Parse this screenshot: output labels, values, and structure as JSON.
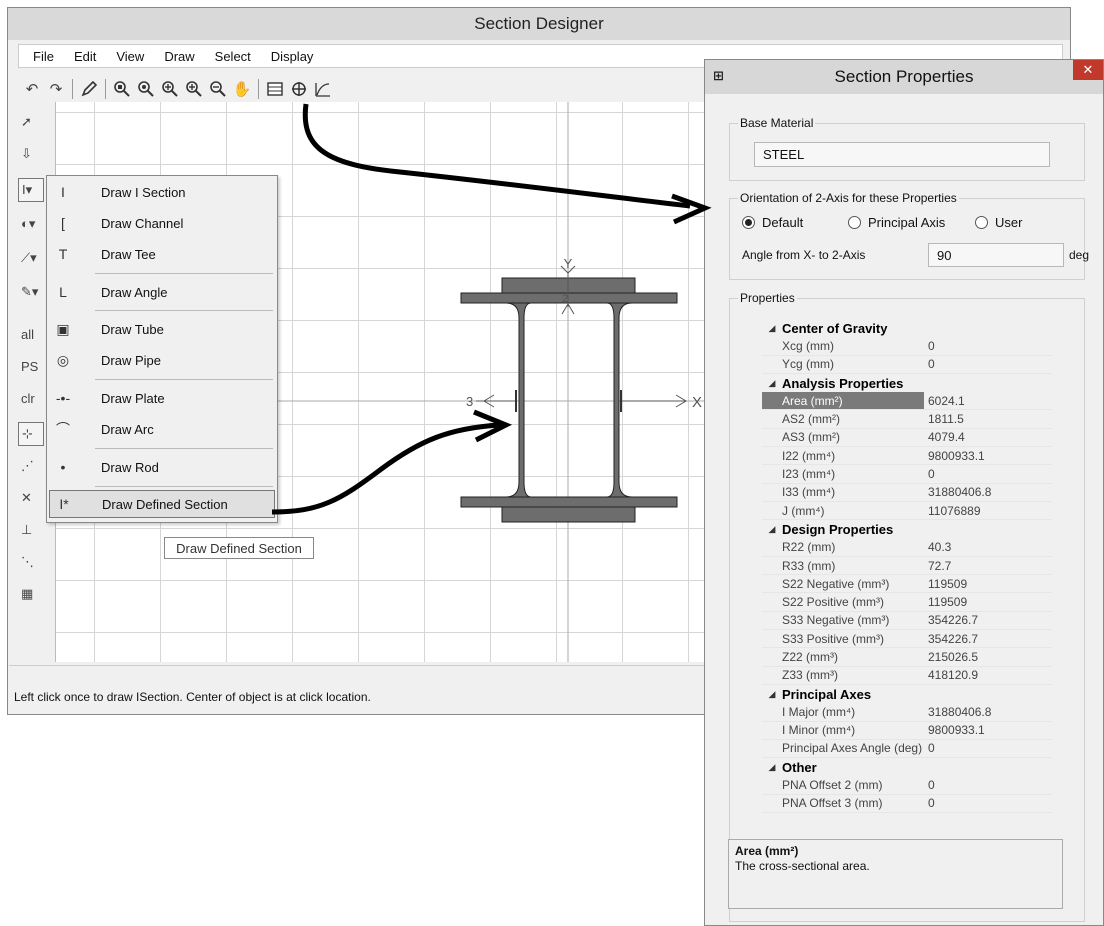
{
  "section_designer": {
    "title": "Section Designer",
    "menu": [
      "File",
      "Edit",
      "View",
      "Draw",
      "Select",
      "Display"
    ],
    "status_text": "Left click once to draw ISection. Center of object is at click location.",
    "draw_menu": [
      {
        "icon": "i-section-icon",
        "glyph": "I",
        "label": "Draw I Section"
      },
      {
        "icon": "channel-icon",
        "glyph": "[",
        "label": "Draw Channel"
      },
      {
        "icon": "tee-icon",
        "glyph": "T",
        "label": "Draw Tee"
      },
      {
        "icon": "angle-icon",
        "glyph": "L",
        "label": "Draw Angle"
      },
      {
        "icon": "tube-icon",
        "glyph": "▣",
        "label": "Draw Tube"
      },
      {
        "icon": "pipe-icon",
        "glyph": "◎",
        "label": "Draw Pipe"
      },
      {
        "icon": "plate-icon",
        "glyph": "-•-",
        "label": "Draw Plate"
      },
      {
        "icon": "arc-icon",
        "glyph": "⌒",
        "label": "Draw Arc"
      },
      {
        "icon": "rod-icon",
        "glyph": "•",
        "label": "Draw Rod"
      },
      {
        "icon": "defined-section-icon",
        "glyph": "I*",
        "label": "Draw Defined Section"
      }
    ],
    "tooltip": "Draw Defined Section",
    "left_tool_labels": {
      "all": "all",
      "ps": "PS",
      "clr": "clr"
    },
    "axis_labels": {
      "y": "Y",
      "x": "X",
      "two": "2",
      "three": "3"
    }
  },
  "section_properties": {
    "title": "Section Properties",
    "base_material_label": "Base Material",
    "base_material": "STEEL",
    "orientation_label": "Orientation of 2-Axis for these Properties",
    "radio_default": "Default",
    "radio_principal": "Principal Axis",
    "radio_user": "User",
    "angle_label": "Angle from X- to 2-Axis",
    "angle_value": "90",
    "angle_unit": "deg",
    "properties_label": "Properties",
    "rows": [
      {
        "type": "cat",
        "label": "Center of Gravity"
      },
      {
        "label": "Xcg (mm)",
        "value": "0"
      },
      {
        "label": "Ycg (mm)",
        "value": "0"
      },
      {
        "type": "cat",
        "label": "Analysis Properties"
      },
      {
        "label": "Area (mm²)",
        "value": "6024.1",
        "highlight": true
      },
      {
        "label": "AS2 (mm²)",
        "value": "1811.5"
      },
      {
        "label": "AS3 (mm²)",
        "value": "4079.4"
      },
      {
        "label": "I22 (mm⁴)",
        "value": "9800933.1"
      },
      {
        "label": "I23 (mm⁴)",
        "value": "0"
      },
      {
        "label": "I33 (mm⁴)",
        "value": "31880406.8"
      },
      {
        "label": "J (mm⁴)",
        "value": "11076889"
      },
      {
        "type": "cat",
        "label": "Design Properties"
      },
      {
        "label": "R22 (mm)",
        "value": "40.3"
      },
      {
        "label": "R33 (mm)",
        "value": "72.7"
      },
      {
        "label": "S22 Negative (mm³)",
        "value": "119509"
      },
      {
        "label": "S22 Positive (mm³)",
        "value": "119509"
      },
      {
        "label": "S33 Negative (mm³)",
        "value": "354226.7"
      },
      {
        "label": "S33 Positive (mm³)",
        "value": "354226.7"
      },
      {
        "label": "Z22 (mm³)",
        "value": "215026.5"
      },
      {
        "label": "Z33 (mm³)",
        "value": "418120.9"
      },
      {
        "type": "cat",
        "label": "Principal Axes"
      },
      {
        "label": "I Major (mm⁴)",
        "value": "31880406.8"
      },
      {
        "label": "I Minor (mm⁴)",
        "value": "9800933.1"
      },
      {
        "label": "Principal Axes Angle (deg)",
        "value": "0"
      },
      {
        "type": "cat",
        "label": "Other"
      },
      {
        "label": "PNA Offset 2 (mm)",
        "value": "0"
      },
      {
        "label": "PNA Offset 3 (mm)",
        "value": "0"
      }
    ],
    "desc_title": "Area (mm²)",
    "desc_text": "The cross-sectional area."
  }
}
